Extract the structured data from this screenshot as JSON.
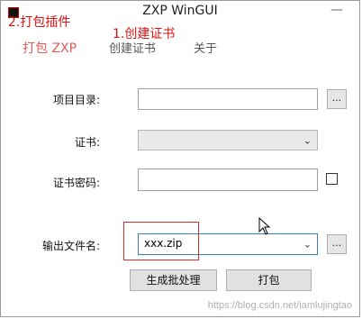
{
  "window": {
    "title": "ZXP WinGUI",
    "minimize": "—"
  },
  "annotations": {
    "step2": "2.打包插件",
    "step1": "1.创建证书"
  },
  "tabs": [
    {
      "label": "打包 ZXP",
      "active": true
    },
    {
      "label": "创建证书",
      "active": false
    },
    {
      "label": "关于",
      "active": false
    }
  ],
  "form": {
    "project_dir_label": "项目目录:",
    "browse_label": "...",
    "cert_label": "证书:",
    "cert_pwd_label": "证书密码:",
    "output_label": "输出文件名:",
    "output_value": "xxx.zip",
    "output_browse": "..."
  },
  "buttons": {
    "batch": "生成批处理",
    "pack": "打包"
  },
  "watermark": "https://blog.csdn.net/iamlujingtao"
}
